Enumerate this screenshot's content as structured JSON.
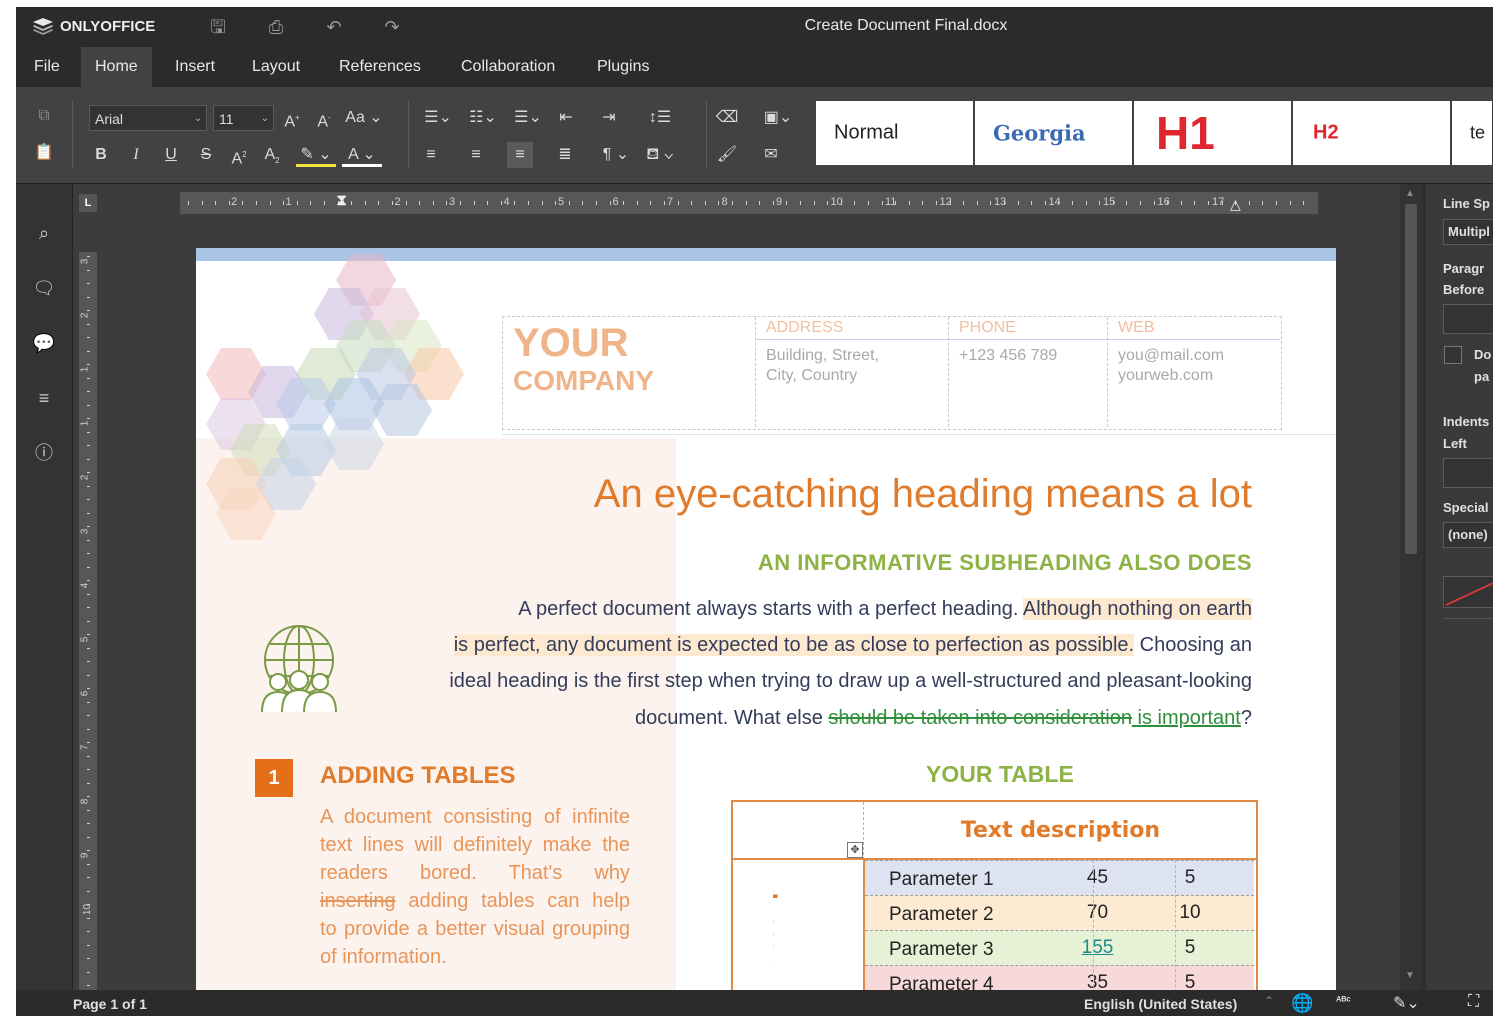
{
  "app": {
    "logo_text": "ONLYOFFICE",
    "document_title": "Create Document Final.docx"
  },
  "menu": [
    "File",
    "Home",
    "Insert",
    "Layout",
    "References",
    "Collaboration",
    "Plugins"
  ],
  "toolbar": {
    "font_name": "Arial",
    "font_size": "11",
    "styles": [
      {
        "label": "Normal",
        "color": "#222222"
      },
      {
        "label": "Georgia",
        "color": "#3b6ab4"
      },
      {
        "label": "H1",
        "color": "#e0262e"
      },
      {
        "label": "H2",
        "color": "#e0262e"
      },
      {
        "label": "te",
        "color": "#222222"
      }
    ]
  },
  "right_panel": {
    "line_spacing_label": "Line Sp",
    "line_spacing_value": "Multipl",
    "paragraph_label": "Paragr",
    "before_label": "Before",
    "checkbox_text_1": "Do",
    "checkbox_text_2": "pa",
    "indents_label": "Indents",
    "left_label": "Left",
    "special_label": "Special",
    "special_value": "(none)"
  },
  "status": {
    "page": "Page 1 of 1",
    "language": "English (United States)"
  },
  "document": {
    "company_line1": "YOUR",
    "company_line2": "COMPANY",
    "contact": {
      "address_header": "ADDRESS",
      "address_value": "Building, Street,\nCity, Country",
      "phone_header": "PHONE",
      "phone_value": "+123 456 789",
      "web_header": "WEB",
      "web_value": "you@mail.com\nyourweb.com"
    },
    "heading": "An eye-catching heading means a lot",
    "subheading": "AN INFORMATIVE SUBHEADING ALSO DOES",
    "para": {
      "l1a": "A perfect document always starts with a perfect heading. ",
      "l1b": "Although nothing on earth",
      "l2a": "is perfect, any document is expected to be as close to perfection as possible.",
      "l2b": " Choosing an",
      "l3": "ideal heading is the first step when trying to draw up a well-structured and pleasant-looking",
      "l4a": "document. What else ",
      "l4_deleted": "should be taken into consideration",
      "l4_inserted": " is important",
      "l4_end": "?"
    },
    "section_number": "1",
    "section_title": "ADDING TABLES",
    "section_text": {
      "l1": "A document consisting of infinite",
      "l2": "text lines will definitely make the",
      "l3": "readers   bored.   That's   why",
      "l4_deleted": "inserting",
      "l4_rest": " adding tables can help",
      "l5": "to provide a better visual grouping",
      "l6": "of information."
    },
    "table_title": "YOUR TABLE",
    "table": {
      "header": "Text description",
      "vertical_header": "Text description",
      "rows": [
        {
          "name": "Parameter 1",
          "v1": "45",
          "v2": "5",
          "color": "#dde3f1"
        },
        {
          "name": "Parameter 2",
          "v1": "70",
          "v2": "10",
          "color": "#fcebd2"
        },
        {
          "name": "Parameter 3",
          "v1": "155",
          "v2": "5",
          "color": "#e6f1d6"
        },
        {
          "name": "Parameter 4",
          "v1": "35",
          "v2": "5",
          "color": "#f8d9d9"
        }
      ]
    }
  },
  "ruler": {
    "h_labels": [
      "2",
      "1",
      "1",
      "2",
      "3",
      "4",
      "5",
      "6",
      "7",
      "8",
      "9",
      "10",
      "11",
      "12",
      "13",
      "14",
      "15",
      "16",
      "17"
    ],
    "v_labels": [
      "3",
      "2",
      "1",
      "1",
      "2",
      "3",
      "4",
      "5",
      "6",
      "7",
      "8",
      "9",
      "10"
    ]
  }
}
